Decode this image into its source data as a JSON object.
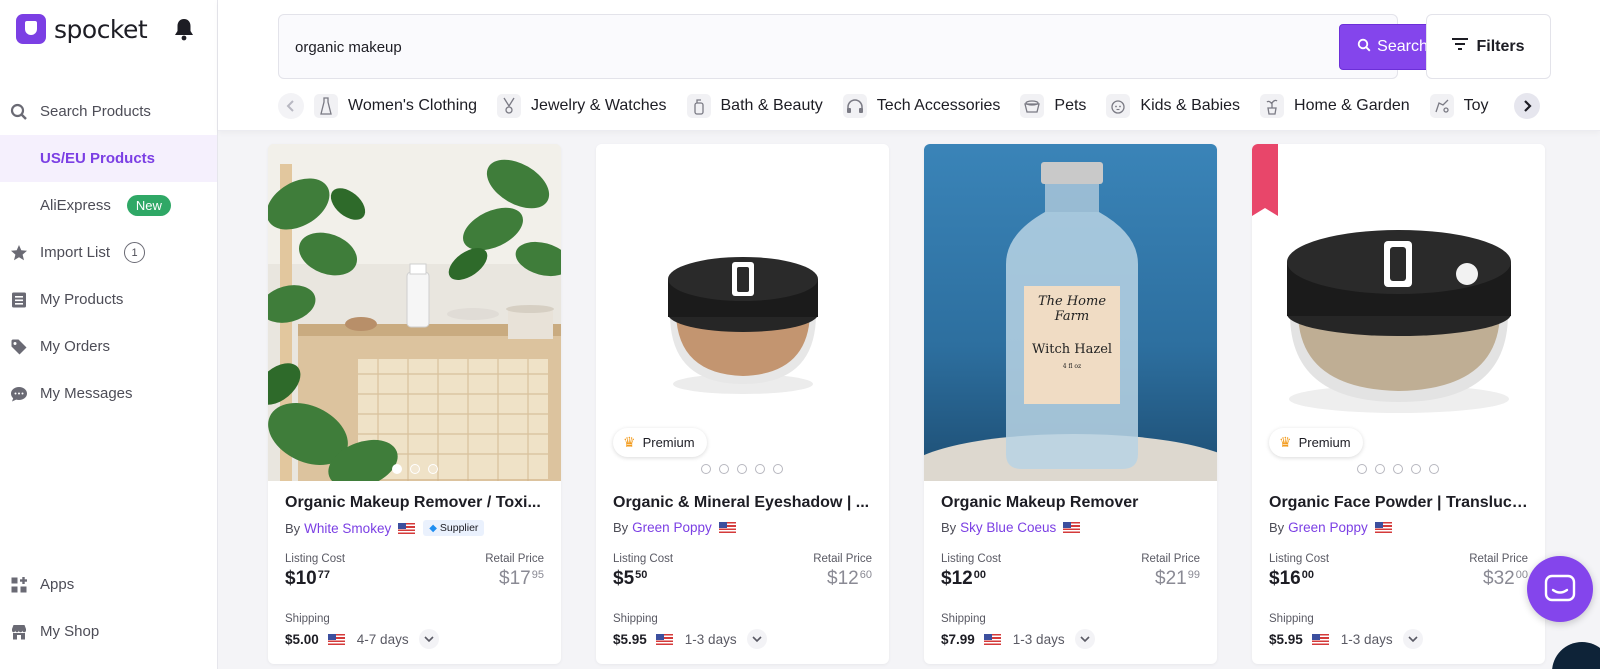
{
  "app": {
    "name": "spocket",
    "brand_color": "#7b3fe4"
  },
  "sidebar": {
    "items": [
      {
        "label": "Search Products",
        "icon": "search-icon",
        "active": false
      },
      {
        "label": "US/EU Products",
        "sub": true,
        "active": true
      },
      {
        "label": "AliExpress",
        "sub": true,
        "badge": "New"
      },
      {
        "label": "Import List",
        "icon": "star-icon",
        "count": "1"
      },
      {
        "label": "My Products",
        "icon": "products-list-icon"
      },
      {
        "label": "My Orders",
        "icon": "tag-icon"
      },
      {
        "label": "My Messages",
        "icon": "chat-bubble-icon"
      }
    ],
    "bottom": [
      {
        "label": "Apps",
        "icon": "apps-grid-icon"
      },
      {
        "label": "My Shop",
        "icon": "shop-icon"
      }
    ]
  },
  "search": {
    "value": "organic makeup",
    "button_label": "Search"
  },
  "filters": {
    "label": "Filters"
  },
  "categories": [
    {
      "label": "Women's Clothing",
      "icon": "dress-icon"
    },
    {
      "label": "Jewelry & Watches",
      "icon": "necklace-icon"
    },
    {
      "label": "Bath & Beauty",
      "icon": "lotion-icon"
    },
    {
      "label": "Tech Accessories",
      "icon": "headphones-icon"
    },
    {
      "label": "Pets",
      "icon": "pet-bowl-icon"
    },
    {
      "label": "Kids & Babies",
      "icon": "baby-icon"
    },
    {
      "label": "Home & Garden",
      "icon": "plant-icon"
    },
    {
      "label": "Toy",
      "icon": "toy-icon"
    }
  ],
  "products": [
    {
      "title": "Organic Makeup Remover / Toxi...",
      "by": "By",
      "supplier": "White Smokey",
      "verified_label": "Supplier",
      "premium": false,
      "listing_label": "Listing Cost",
      "listing_whole": "$10",
      "listing_cents": "77",
      "retail_label": "Retail Price",
      "retail_whole": "$17",
      "retail_cents": "95",
      "shipping_label": "Shipping",
      "shipping_price": "$5.00",
      "shipping_days": "4-7 days",
      "image": "plants-and-bottle"
    },
    {
      "title": "Organic & Mineral Eyeshadow | ...",
      "by": "By",
      "supplier": "Green Poppy",
      "premium": true,
      "premium_label": "Premium",
      "listing_label": "Listing Cost",
      "listing_whole": "$5",
      "listing_cents": "50",
      "retail_label": "Retail Price",
      "retail_whole": "$12",
      "retail_cents": "60",
      "shipping_label": "Shipping",
      "shipping_price": "$5.95",
      "shipping_days": "1-3 days",
      "image": "eyeshadow-jar"
    },
    {
      "title": "Organic Makeup Remover",
      "by": "By",
      "supplier": "Sky Blue Coeus",
      "premium": false,
      "listing_label": "Listing Cost",
      "listing_whole": "$12",
      "listing_cents": "00",
      "retail_label": "Retail Price",
      "retail_whole": "$21",
      "retail_cents": "99",
      "shipping_label": "Shipping",
      "shipping_price": "$7.99",
      "shipping_days": "1-3 days",
      "image": "witch-hazel-bottle",
      "bottle_label": [
        "The Home",
        "Farm",
        "Witch Hazel",
        "4 fl oz"
      ]
    },
    {
      "title": "Organic Face Powder | Translucent",
      "by": "By",
      "supplier": "Green Poppy",
      "premium": true,
      "premium_label": "Premium",
      "listing_label": "Listing Cost",
      "listing_whole": "$16",
      "listing_cents": "00",
      "retail_label": "Retail Price",
      "retail_whole": "$32",
      "retail_cents": "00",
      "shipping_label": "Shipping",
      "shipping_price": "$5.95",
      "shipping_days": "1-3 days",
      "image": "face-powder-jar"
    }
  ]
}
